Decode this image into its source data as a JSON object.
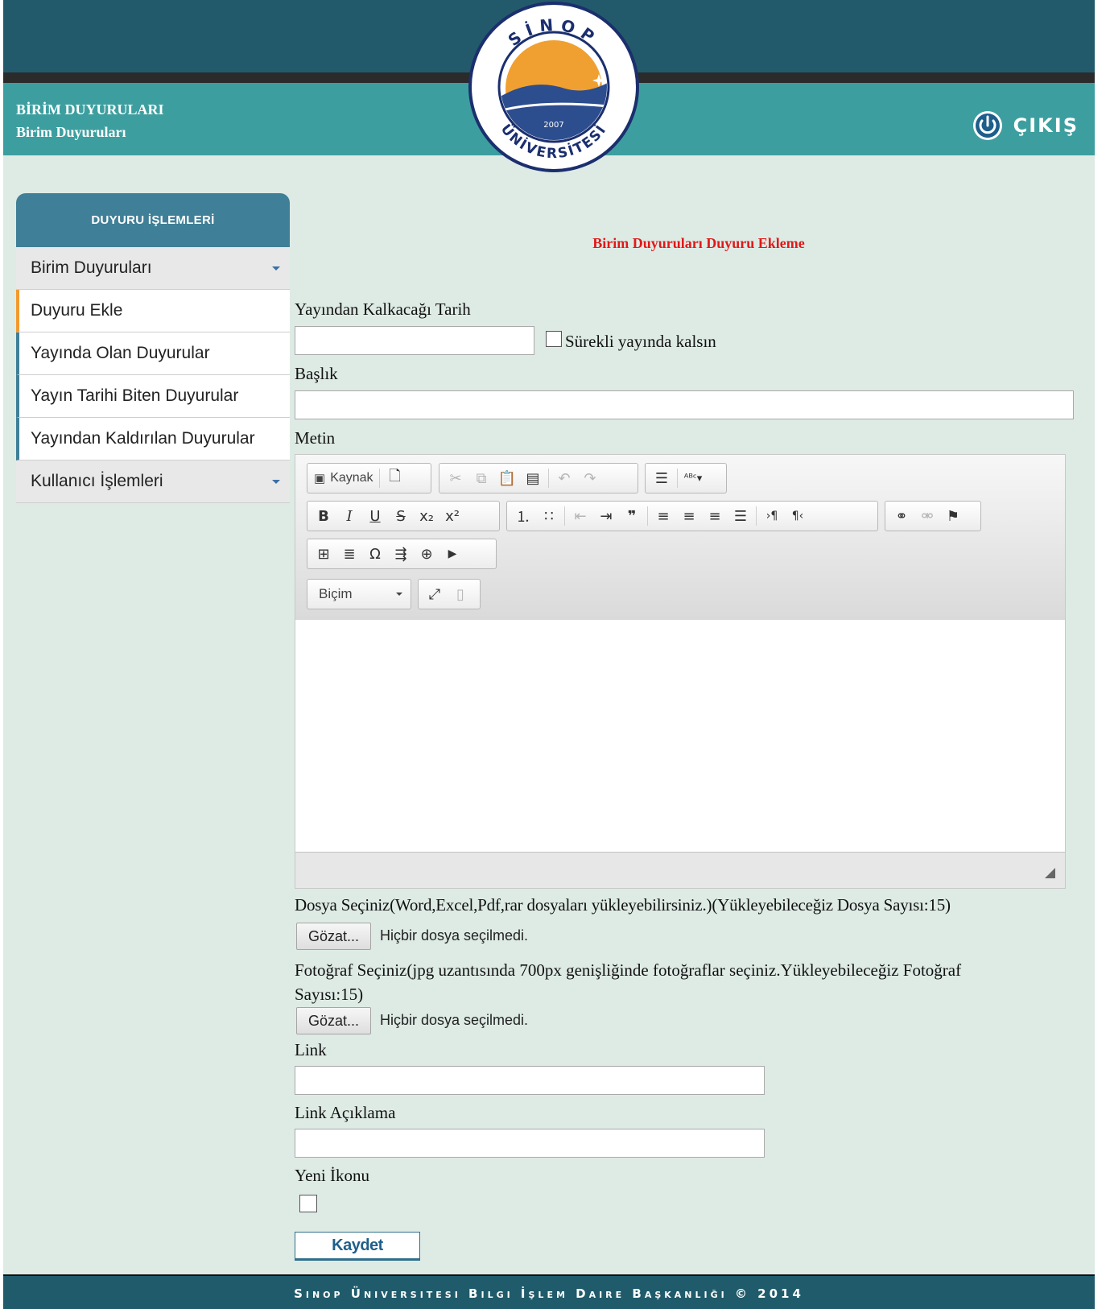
{
  "header": {
    "title_line1": "BİRİM DUYURULARI",
    "title_line2": "Birim Duyuruları",
    "logout_label": "ÇIKIŞ",
    "logo": {
      "top_text": "SİNOP",
      "bottom_text": "ÜNİVERSİTESİ",
      "year": "2007"
    }
  },
  "sidebar": {
    "heading": "DUYURU İŞLEMLERİ",
    "groups": [
      {
        "label": "Birim Duyuruları"
      },
      {
        "label": "Kullanıcı İşlemleri"
      }
    ],
    "items": [
      {
        "label": "Duyuru Ekle",
        "active": true
      },
      {
        "label": "Yayında Olan Duyurular"
      },
      {
        "label": "Yayın Tarihi Biten Duyurular"
      },
      {
        "label": "Yayından Kaldırılan Duyurular"
      }
    ]
  },
  "form": {
    "title": "Birim Duyuruları Duyuru Ekleme",
    "expire_date_label": "Yayından Kalkacağı Tarih",
    "expire_date_value": "",
    "always_published_label": "Sürekli yayında kalsın",
    "title_label": "Başlık",
    "title_value": "",
    "text_label": "Metin",
    "editor": {
      "source_label": "Kaynak",
      "format_label": "Biçim"
    },
    "file_label": "Dosya Seçiniz(Word,Excel,Pdf,rar dosyaları yükleyebilirsiniz.)(Yükleyebileceğiz Dosya Sayısı:15)",
    "photo_label_line1": "Fotoğraf Seçiniz(jpg uzantısında 700px genişliğinde fotoğraflar seçiniz.Yükleyebileceğiz Fotoğraf",
    "photo_label_line2": "Sayısı:15)",
    "browse_label": "Gözat...",
    "no_file_label": "Hiçbir dosya seçilmedi.",
    "link_label": "Link",
    "link_value": "",
    "link_desc_label": "Link Açıklama",
    "link_desc_value": "",
    "new_icon_label": "Yeni İkonu",
    "save_label": "Kaydet"
  },
  "footer": {
    "text": "Sinop Üniversitesi Bilgi İşlem Daire Başkanlığı © 2014"
  },
  "colors": {
    "top_bar": "#225a6b",
    "teal_bar": "#3d9e9f",
    "page_bg": "#deebe5",
    "sidebar_header": "#3f7f97",
    "active_accent": "#f29a2e",
    "form_title": "#e11919",
    "logo_sun": "#f0a030",
    "logo_sea": "#2c4d8e"
  }
}
